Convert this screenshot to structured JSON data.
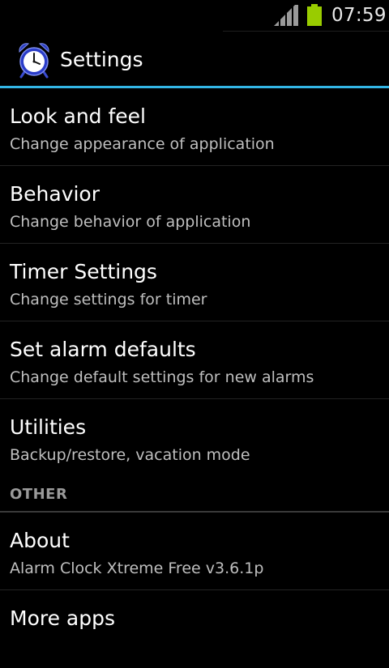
{
  "status_bar": {
    "time": "07:59",
    "signal_icon": "signal-bars-icon",
    "battery_icon": "battery-icon",
    "battery_color": "#99cc00"
  },
  "action_bar": {
    "title": "Settings",
    "app_icon": "alarm-clock-icon",
    "accent_color": "#33b5e5"
  },
  "preferences": [
    {
      "title": "Look and feel",
      "summary": "Change appearance of application"
    },
    {
      "title": "Behavior",
      "summary": "Change behavior of application"
    },
    {
      "title": "Timer Settings",
      "summary": "Change settings for timer"
    },
    {
      "title": "Set alarm defaults",
      "summary": "Change default settings for new alarms"
    },
    {
      "title": "Utilities",
      "summary": "Backup/restore, vacation mode"
    }
  ],
  "other_category": {
    "label": "OTHER",
    "items": [
      {
        "title": "About",
        "summary": "Alarm Clock Xtreme Free v3.6.1p"
      },
      {
        "title": "More apps",
        "summary": ""
      }
    ]
  }
}
